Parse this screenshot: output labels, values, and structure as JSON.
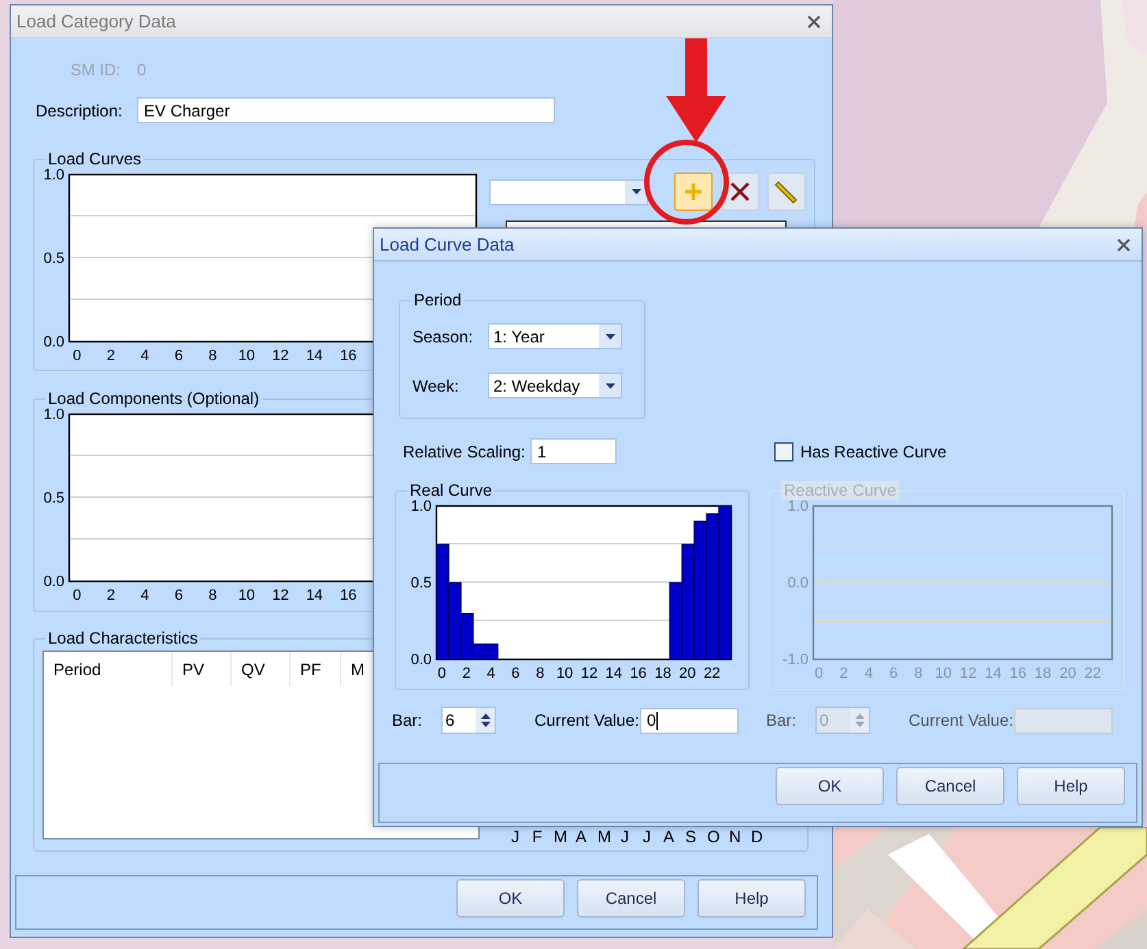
{
  "main_window": {
    "title": "Load Category Data",
    "active": false,
    "sm_id": {
      "label": "SM ID:",
      "value": "0",
      "disabled": true
    },
    "description": {
      "label": "Description:",
      "value": "EV Charger"
    },
    "load_curves": {
      "title": "Load Curves",
      "y_labels": [
        "1.0",
        "0.5",
        "0.0"
      ],
      "x_labels": [
        "0",
        "2",
        "4",
        "6",
        "8",
        "10",
        "12",
        "14",
        "16"
      ],
      "toolbar": [
        {
          "kind": "add",
          "focused": true
        },
        {
          "kind": "delete",
          "focused": false
        },
        {
          "kind": "edit",
          "focused": false
        }
      ]
    },
    "load_components": {
      "title": "Load Components (Optional)",
      "y_labels": [
        "1.0",
        "0.5",
        "0.0"
      ],
      "x_labels": [
        "0",
        "2",
        "4",
        "6",
        "8",
        "10",
        "12",
        "14",
        "16"
      ]
    },
    "load_characteristics": {
      "title": "Load Characteristics",
      "columns": [
        "Period",
        "PV",
        "QV",
        "PF",
        "M"
      ],
      "months": [
        "J",
        "F",
        "M",
        "A",
        "M",
        "J",
        "J",
        "A",
        "S",
        "O",
        "N",
        "D"
      ]
    },
    "buttons": [
      "OK",
      "Cancel",
      "Help"
    ]
  },
  "curve_dialog": {
    "title": "Load Curve Data",
    "active": true,
    "period": {
      "title": "Period",
      "season": {
        "label": "Season:",
        "value": "1: Year"
      },
      "week": {
        "label": "Week:",
        "value": "2: Weekday"
      }
    },
    "relative_scaling": {
      "label": "Relative Scaling:",
      "value": "1"
    },
    "has_reactive_curve": {
      "label": "Has Reactive Curve",
      "checked": false
    },
    "real_curve": {
      "title": "Real Curve",
      "disabled": false,
      "chart_data": {
        "type": "bar",
        "x": [
          0,
          1,
          2,
          3,
          4,
          5,
          6,
          7,
          8,
          9,
          10,
          11,
          12,
          13,
          14,
          15,
          16,
          17,
          18,
          19,
          20,
          21,
          22,
          23
        ],
        "values": [
          0.75,
          0.5,
          0.3,
          0.1,
          0.1,
          0,
          0,
          0,
          0,
          0,
          0,
          0,
          0,
          0,
          0,
          0,
          0,
          0,
          0,
          0.5,
          0.75,
          0.9,
          0.95,
          1.0
        ],
        "xlim": [
          -0.5,
          23.5
        ],
        "ylim": [
          0,
          1
        ],
        "yticks": [
          {
            "value": 1,
            "label": "1.0"
          },
          {
            "value": 0.5,
            "label": "0.5"
          },
          {
            "value": 0,
            "label": "0.0"
          }
        ],
        "xticks": [
          {
            "value": 0,
            "label": "0"
          },
          {
            "value": 2,
            "label": "2"
          },
          {
            "value": 4,
            "label": "4"
          },
          {
            "value": 6,
            "label": "6"
          },
          {
            "value": 8,
            "label": "8"
          },
          {
            "value": 10,
            "label": "10"
          },
          {
            "value": 12,
            "label": "12"
          },
          {
            "value": 14,
            "label": "14"
          },
          {
            "value": 16,
            "label": "16"
          },
          {
            "value": 18,
            "label": "18"
          },
          {
            "value": 20,
            "label": "20"
          },
          {
            "value": 22,
            "label": "22"
          }
        ]
      }
    },
    "reactive_curve": {
      "title": "Reactive Curve",
      "disabled": true,
      "y_labels": [
        "1.0",
        "0.0",
        "-1.0"
      ],
      "x_labels": [
        "0",
        "2",
        "4",
        "6",
        "8",
        "10",
        "12",
        "14",
        "16",
        "18",
        "20",
        "22"
      ]
    },
    "real_bar": {
      "label": "Bar:",
      "value": "6",
      "disabled": false
    },
    "real_current": {
      "label": "Current Value:",
      "value": "0",
      "disabled": false
    },
    "reactive_bar": {
      "label": "Bar:",
      "value": "0",
      "disabled": true
    },
    "reactive_current": {
      "label": "Current Value:",
      "disabled": true
    },
    "buttons": [
      "OK",
      "Cancel",
      "Help"
    ]
  }
}
